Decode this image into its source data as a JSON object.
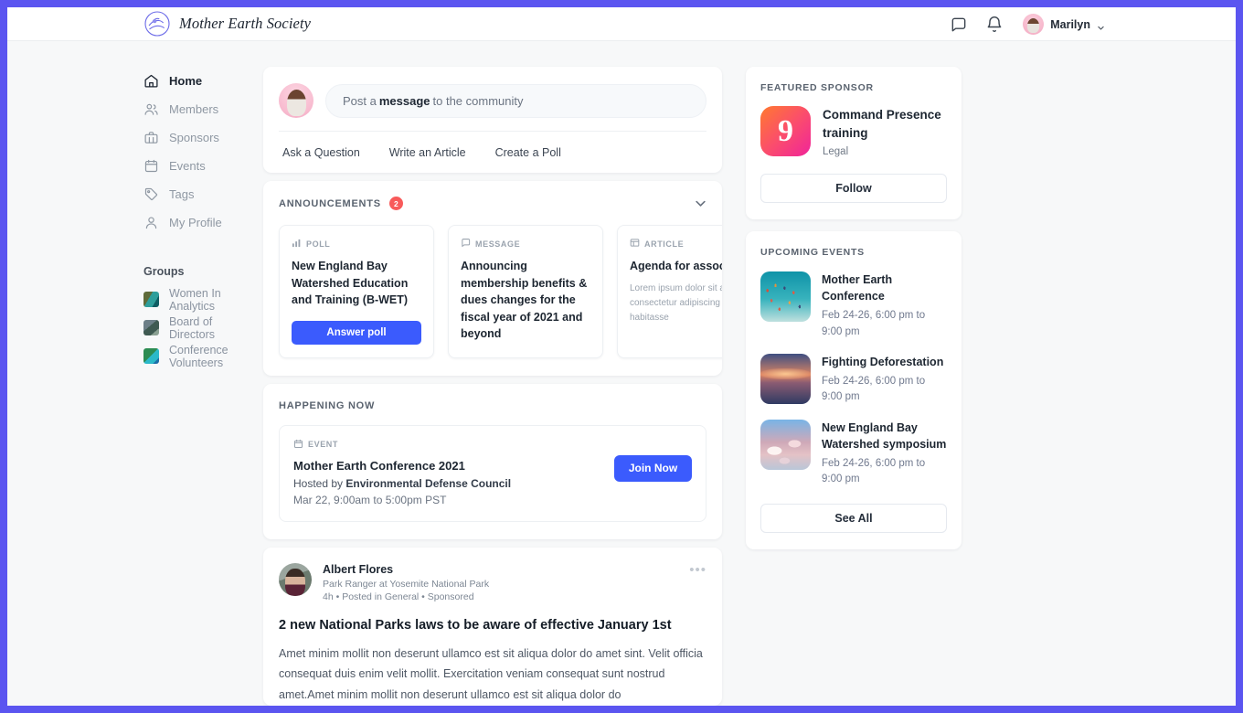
{
  "header": {
    "brand_name": "Mother Earth Society",
    "logo_icon": "wave-circle-logo",
    "messages_icon": "chat-bubble-icon",
    "notifications_icon": "bell-icon",
    "user_name": "Marilyn",
    "caret_icon": "chevron-down-icon"
  },
  "sidebar": {
    "items": [
      {
        "label": "Home",
        "icon": "home-icon",
        "active": true
      },
      {
        "label": "Members",
        "icon": "people-icon",
        "active": false
      },
      {
        "label": "Sponsors",
        "icon": "briefcase-icon",
        "active": false
      },
      {
        "label": "Events",
        "icon": "calendar-icon",
        "active": false
      },
      {
        "label": "Tags",
        "icon": "tag-icon",
        "active": false
      },
      {
        "label": "My Profile",
        "icon": "person-icon",
        "active": false
      }
    ],
    "groups_title": "Groups",
    "groups": [
      {
        "label": "Women In Analytics"
      },
      {
        "label": "Board of Directors"
      },
      {
        "label": "Conference Volunteers"
      }
    ]
  },
  "composer": {
    "placeholder_pre": "Post a",
    "placeholder_bold": "message",
    "placeholder_post": "to the community",
    "actions": [
      "Ask a Question",
      "Write an Article",
      "Create a Poll"
    ]
  },
  "announcements": {
    "title": "ANNOUNCEMENTS",
    "badge": "2",
    "collapse_icon": "chevron-down-icon",
    "cards": [
      {
        "kind": "POLL",
        "kind_icon": "bar-chart-icon",
        "heading": "New England Bay Watershed Education and Training (B-WET)",
        "body": "",
        "button": "Answer poll"
      },
      {
        "kind": "MESSAGE",
        "kind_icon": "message-icon",
        "heading": "Announcing membership benefits & dues changes for the fiscal year of 2021 and beyond",
        "body": "",
        "button": ""
      },
      {
        "kind": "ARTICLE",
        "kind_icon": "article-icon",
        "heading": "Agenda for association",
        "body": "Lorem ipsum dolor sit amet, consectetur adipiscing elit, sed habitasse",
        "button": ""
      }
    ]
  },
  "happening_now": {
    "title": "HAPPENING NOW",
    "kind": "EVENT",
    "kind_icon": "calendar-icon",
    "name": "Mother Earth Conference 2021",
    "host_prefix": "Hosted by",
    "host": "Environmental Defense Council",
    "time": "Mar 22, 9:00am to 5:00pm PST",
    "button": "Join Now"
  },
  "post": {
    "author": "Albert Flores",
    "role": "Park Ranger at Yosemite National Park",
    "meta": "4h • Posted in General • Sponsored",
    "more_icon": "more-horizontal-icon",
    "title": "2 new National Parks laws to be aware of effective January 1st",
    "body": "Amet minim mollit non deserunt ullamco est sit aliqua dolor do amet sint. Velit officia consequat duis enim velit mollit. Exercitation veniam consequat sunt nostrud amet.Amet minim mollit non deserunt ullamco est sit aliqua dolor do"
  },
  "sponsor": {
    "title": "FEATURED SPONSOR",
    "logo_text": "9",
    "name": "Command Presence training",
    "category": "Legal",
    "button": "Follow"
  },
  "events": {
    "title": "UPCOMING EVENTS",
    "items": [
      {
        "name": "Mother Earth Conference",
        "date": "Feb 24-26, 6:00 pm to 9:00 pm",
        "thumb": "balloons-photo"
      },
      {
        "name": "Fighting Deforestation",
        "date": "Feb 24-26, 6:00 pm to 9:00 pm",
        "thumb": "sunset-lake-photo"
      },
      {
        "name": "New England Bay Watershed symposium",
        "date": "Feb 24-26, 6:00 pm to 9:00 pm",
        "thumb": "clouds-photo"
      }
    ],
    "see_all": "See All"
  },
  "colors": {
    "frame_border": "#5b55f0",
    "primary_button": "#3b5bfd",
    "badge_red": "#f85a5a",
    "page_bg": "#f7f8f9"
  }
}
